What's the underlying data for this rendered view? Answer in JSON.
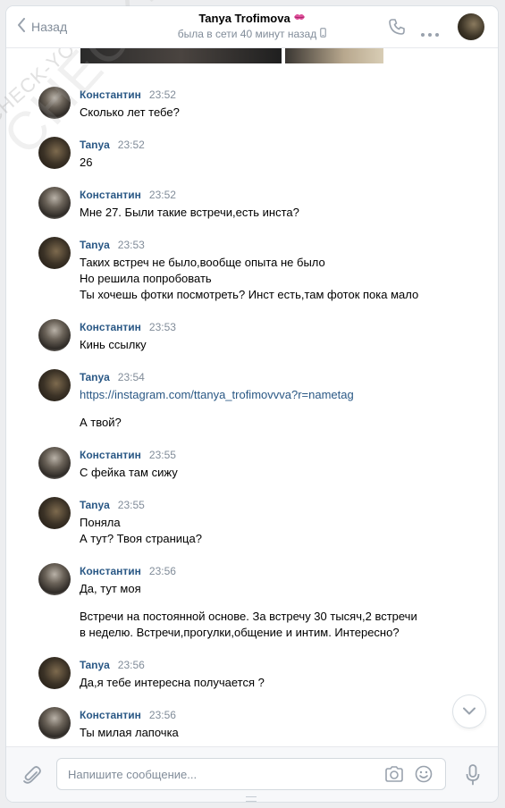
{
  "header": {
    "back_label": "Назад",
    "title": "Tanya Trofimova",
    "status": "была в сети 40 минут назад"
  },
  "messages": [
    {
      "author": "Константин",
      "time": "23:52",
      "lines": [
        "Сколько лет тебе?"
      ]
    },
    {
      "author": "Tanya",
      "time": "23:52",
      "lines": [
        "26"
      ]
    },
    {
      "author": "Константин",
      "time": "23:52",
      "lines": [
        "Мне 27. Были такие встречи,есть инста?"
      ]
    },
    {
      "author": "Tanya",
      "time": "23:53",
      "lines": [
        "Таких встреч не было,вообще опыта не было",
        "Но решила попробовать",
        "Ты хочешь фотки посмотреть? Инст есть,там фоток пока мало"
      ]
    },
    {
      "author": "Константин",
      "time": "23:53",
      "lines": [
        "Кинь ссылку"
      ]
    },
    {
      "author": "Tanya",
      "time": "23:54",
      "link": "https://instagram.com/ttanya_trofimovvva?r=nametag",
      "lines": [
        "А твой?"
      ]
    },
    {
      "author": "Константин",
      "time": "23:55",
      "lines": [
        "С фейка там сижу"
      ]
    },
    {
      "author": "Tanya",
      "time": "23:55",
      "lines": [
        "Поняла",
        "А тут? Твоя страница?"
      ]
    },
    {
      "author": "Константин",
      "time": "23:56",
      "lines": [
        "Да, тут моя",
        "Встречи на постоянной основе. За встречу 30 тысяч,2 встречи",
        "в неделю. Встречи,прогулки,общение и интим. Интересно?"
      ]
    },
    {
      "author": "Tanya",
      "time": "23:56",
      "lines": [
        "Да,я тебе интересна получается ?"
      ]
    },
    {
      "author": "Константин",
      "time": "23:56",
      "lines": [
        "Ты милая лапочка"
      ]
    }
  ],
  "composer": {
    "placeholder": "Напишите сообщение..."
  },
  "watermark": "CHECK-YOU.ME",
  "colors": {
    "author": "#2a5885",
    "meta": "#818c99",
    "icon": "#99a2ad",
    "background": "#edeef0"
  },
  "icons": [
    "chevron-left-icon",
    "kiss-emoji-icon",
    "mobile-icon",
    "phone-icon",
    "more-icon",
    "paperclip-icon",
    "camera-icon",
    "smile-icon",
    "microphone-icon",
    "chevron-down-icon"
  ]
}
